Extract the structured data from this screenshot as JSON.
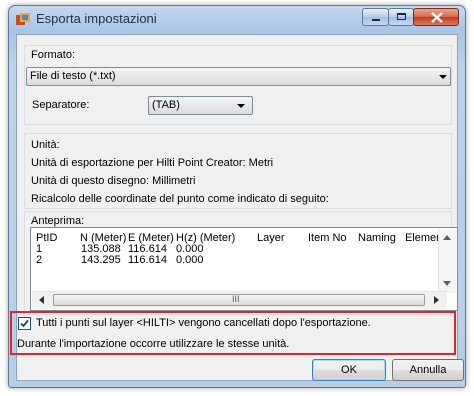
{
  "window": {
    "title": "Esporta impostazioni"
  },
  "format": {
    "group_label": "Formato:",
    "selected": "File di testo (*.txt)",
    "separator_label": "Separatore:",
    "separator_value": "(TAB)"
  },
  "units": {
    "group_label": "Unità:",
    "export_units": "Unità di esportazione per Hilti Point Creator: Metri",
    "drawing_units": "Unità di questo disegno: Millimetri",
    "recalc": "Ricalcolo delle coordinate del punto come indicato di seguito:"
  },
  "preview": {
    "group_label": "Anteprima:",
    "columns": [
      "PtID",
      "N (Meter)",
      "E (Meter)",
      "H(z) (Meter)",
      "Layer",
      "Item No",
      "Naming",
      "Elemen"
    ],
    "rows": [
      [
        "1",
        "135.088",
        "116.614",
        "0.000"
      ],
      [
        "2",
        "143.295",
        "116.614",
        "0.000"
      ]
    ],
    "scroll_grip": "III"
  },
  "notice": {
    "checkbox_checked": true,
    "checkbox_label": "Tutti i punti sul layer <HILTI> vengono cancellati dopo l'esportazione.",
    "note": "Durante l'importazione occorre utilizzare le stesse unità."
  },
  "buttons": {
    "ok": "OK",
    "cancel": "Annulla"
  },
  "colors": {
    "highlight_border": "#e0252e"
  }
}
